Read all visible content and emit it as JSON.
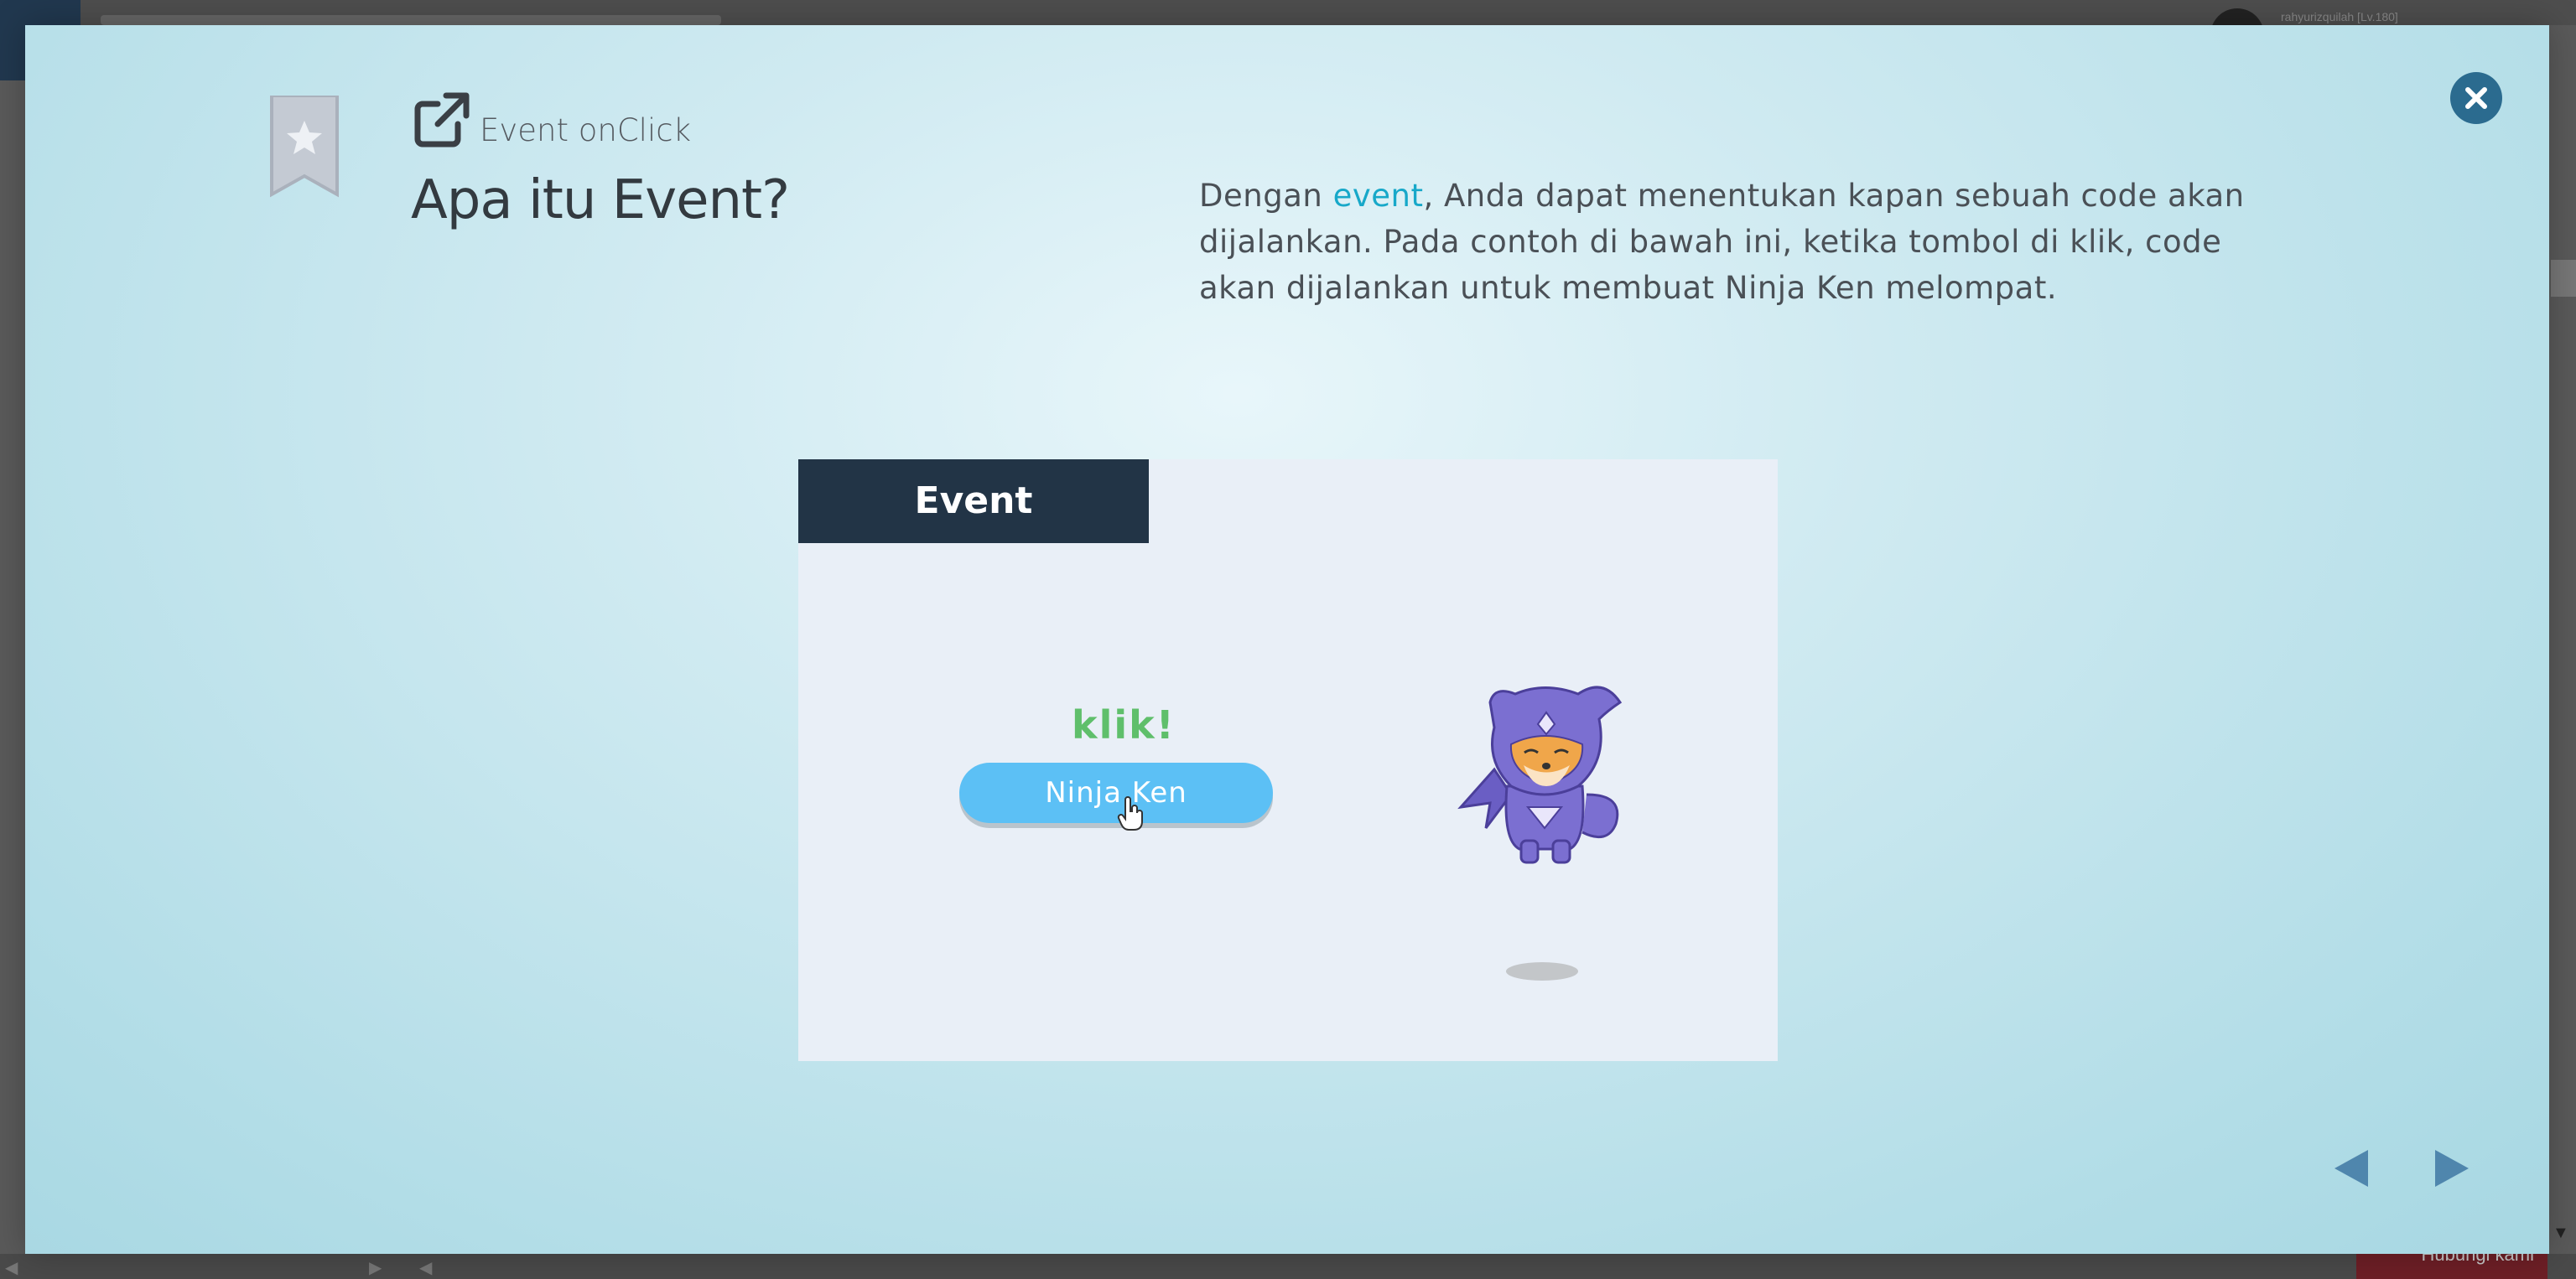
{
  "background": {
    "user_label": "rahyurizquilah [Lv.180]",
    "footer_button": "Hubungi kami"
  },
  "modal": {
    "eyebrow": "Event onClick",
    "title": "Apa itu Event?",
    "description": {
      "prefix": "Dengan ",
      "highlight": "event",
      "suffix": ", Anda dapat menentukan kapan sebuah code akan dijalankan. Pada contoh di bawah ini, ketika tombol di klik, code akan dijalankan untuk membuat Ninja Ken melompat."
    },
    "demo": {
      "tab_label": "Event",
      "click_text": "klik!",
      "button_label": "Ninja Ken"
    }
  },
  "icons": {
    "bookmark": "bookmark-star-icon",
    "external": "external-link-icon",
    "close": "close-icon",
    "prev": "arrow-left-icon",
    "next": "arrow-right-icon",
    "cursor": "hand-cursor-icon"
  },
  "colors": {
    "accent": "#17a8c9",
    "close_button": "#2b6b8f",
    "tab_bg": "#223446",
    "button_bg": "#5cc0f5",
    "click_text": "#5fbf6b",
    "nav_arrows": "#4f86ad"
  }
}
